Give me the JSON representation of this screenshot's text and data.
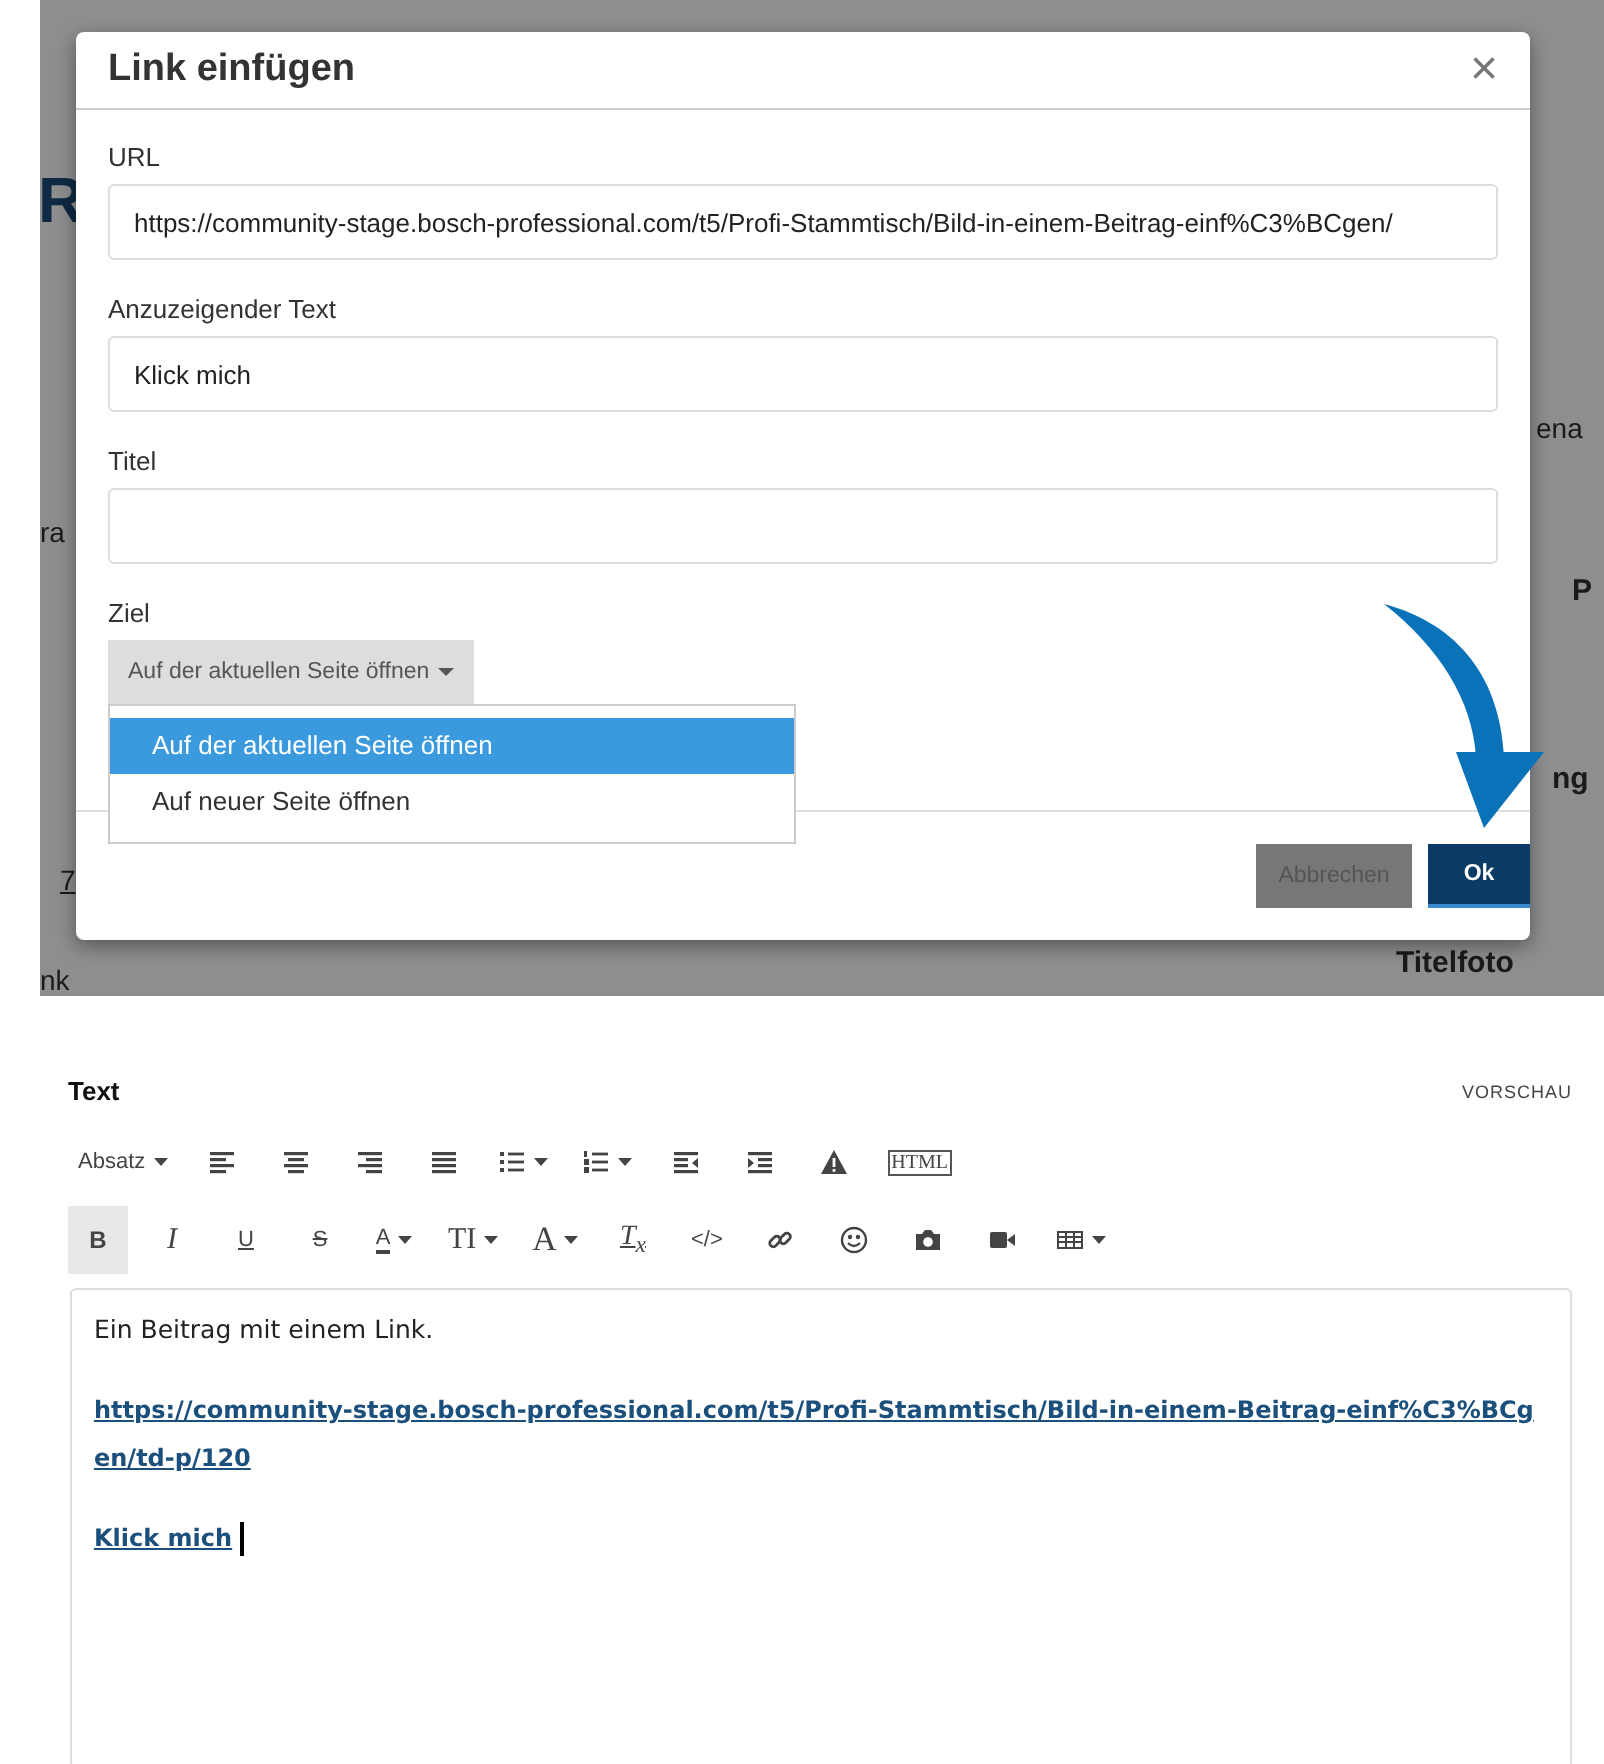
{
  "background_page": {
    "fragments": [
      {
        "text": "R"
      },
      {
        "text": "ra"
      },
      {
        "text": "7"
      },
      {
        "text": "nk"
      },
      {
        "text": "ena"
      },
      {
        "text": "P"
      },
      {
        "text": "ng"
      },
      {
        "text": "Titelfoto"
      }
    ]
  },
  "dialog": {
    "title": "Link einfügen",
    "close": "×",
    "fields": [
      {
        "label": "URL",
        "value": "https://community-stage.bosch-professional.com/t5/Profi-Stammtisch/Bild-in-einem-Beitrag-einf%C3%BCgen/"
      },
      {
        "label": "Anzuzeigender Text",
        "value": "Klick mich"
      },
      {
        "label": "Titel"
      }
    ],
    "target": {
      "label": "Ziel",
      "button": "Auf der aktuellen Seite öffnen",
      "options": [
        {
          "label": "Auf der aktuellen Seite öffnen",
          "selected": true
        },
        {
          "label": "Auf neuer Seite öffnen",
          "selected": false
        }
      ]
    },
    "buttons": [
      {
        "label": "Abbrechen",
        "kind": "secondary"
      },
      {
        "label": "Ok",
        "kind": "primary"
      }
    ]
  },
  "editor": {
    "label": "Text",
    "preview": "VORSCHAU",
    "toolbar_rows": [
      [
        {
          "kind": "text",
          "label": "Absatz",
          "caret": true,
          "active": false
        },
        {
          "kind": "align_left",
          "active": false
        },
        {
          "kind": "align_center",
          "active": false
        },
        {
          "kind": "align_right",
          "active": false
        },
        {
          "kind": "justify",
          "active": false
        },
        {
          "kind": "bullets",
          "caret": true,
          "active": false
        },
        {
          "kind": "numbered",
          "caret": true,
          "active": false
        },
        {
          "kind": "outdent",
          "active": false
        },
        {
          "kind": "indent",
          "active": false
        },
        {
          "kind": "warning",
          "active": false
        },
        {
          "kind": "boxed",
          "label": "HTML",
          "active": false
        }
      ],
      [
        {
          "kind": "bold",
          "label": "B",
          "active": true
        },
        {
          "kind": "italic",
          "label": "I",
          "active": false
        },
        {
          "kind": "underline",
          "label": "U",
          "active": false
        },
        {
          "kind": "strike",
          "label": "S",
          "active": false
        },
        {
          "kind": "color",
          "label": "A",
          "caret": true,
          "active": false
        },
        {
          "kind": "serif",
          "label": "TI",
          "caret": true,
          "active": false
        },
        {
          "kind": "serif_large",
          "label": "A",
          "caret": true,
          "active": false
        },
        {
          "kind": "clear",
          "label": "T$_{x}$",
          "active": false
        },
        {
          "kind": "text",
          "label": "</>",
          "active": false
        },
        {
          "kind": "link",
          "active": false
        },
        {
          "kind": "smiley",
          "active": false
        },
        {
          "kind": "camera",
          "active": false
        },
        {
          "kind": "video",
          "active": false
        },
        {
          "kind": "table",
          "caret": true,
          "active": false
        }
      ]
    ],
    "paragraphs": [
      {
        "kind": "plain",
        "text": "Ein Beitrag mit einem Link.",
        "cursor": false
      },
      {
        "kind": "link",
        "text": "https://community-stage.bosch-professional.com/t5/Profi-Stammtisch/Bild-in-einem-Beitrag-einf%C3%BCgen/td-p/120",
        "cursor": false
      },
      {
        "kind": "link",
        "text": "Klick mich",
        "cursor": true
      }
    ]
  }
}
